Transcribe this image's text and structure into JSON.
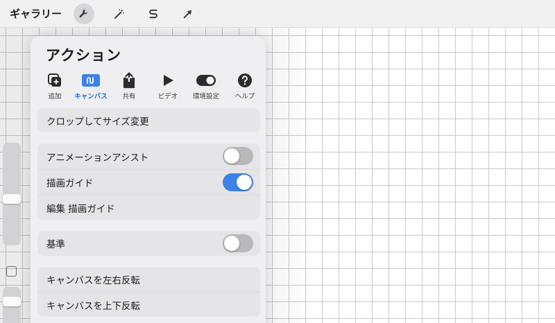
{
  "topbar": {
    "gallery_label": "ギャラリー",
    "tools": [
      {
        "icon": "wrench-icon",
        "active": true
      },
      {
        "icon": "magic-wand-icon",
        "active": false
      },
      {
        "icon": "selection-s-icon",
        "active": false
      },
      {
        "icon": "transform-arrow-icon",
        "active": false
      }
    ]
  },
  "panel": {
    "title": "アクション",
    "tabs": [
      {
        "label": "追加",
        "icon": "add-icon"
      },
      {
        "label": "キャンバス",
        "icon": "canvas-icon",
        "active": true
      },
      {
        "label": "共有",
        "icon": "share-icon"
      },
      {
        "label": "ビデオ",
        "icon": "play-icon"
      },
      {
        "label": "環境設定",
        "icon": "toggle-icon"
      },
      {
        "label": "ヘルプ",
        "icon": "help-icon"
      }
    ],
    "crop_resize": "クロップしてサイズ変更",
    "animation_assist": {
      "label": "アニメーションアシスト",
      "on": false
    },
    "drawing_guide": {
      "label": "描画ガイド",
      "on": true
    },
    "edit_drawing_guide": "編集 描画ガイド",
    "reference": {
      "label": "基準",
      "on": false
    },
    "flip_horizontal": "キャンバスを左右反転",
    "flip_vertical": "キャンバスを上下反転"
  },
  "colors": {
    "accent": "#3d82e8",
    "toggle_off": "#b9b9bd",
    "panel_bg": "#efeff1",
    "row_bg": "#e5e5e7"
  }
}
